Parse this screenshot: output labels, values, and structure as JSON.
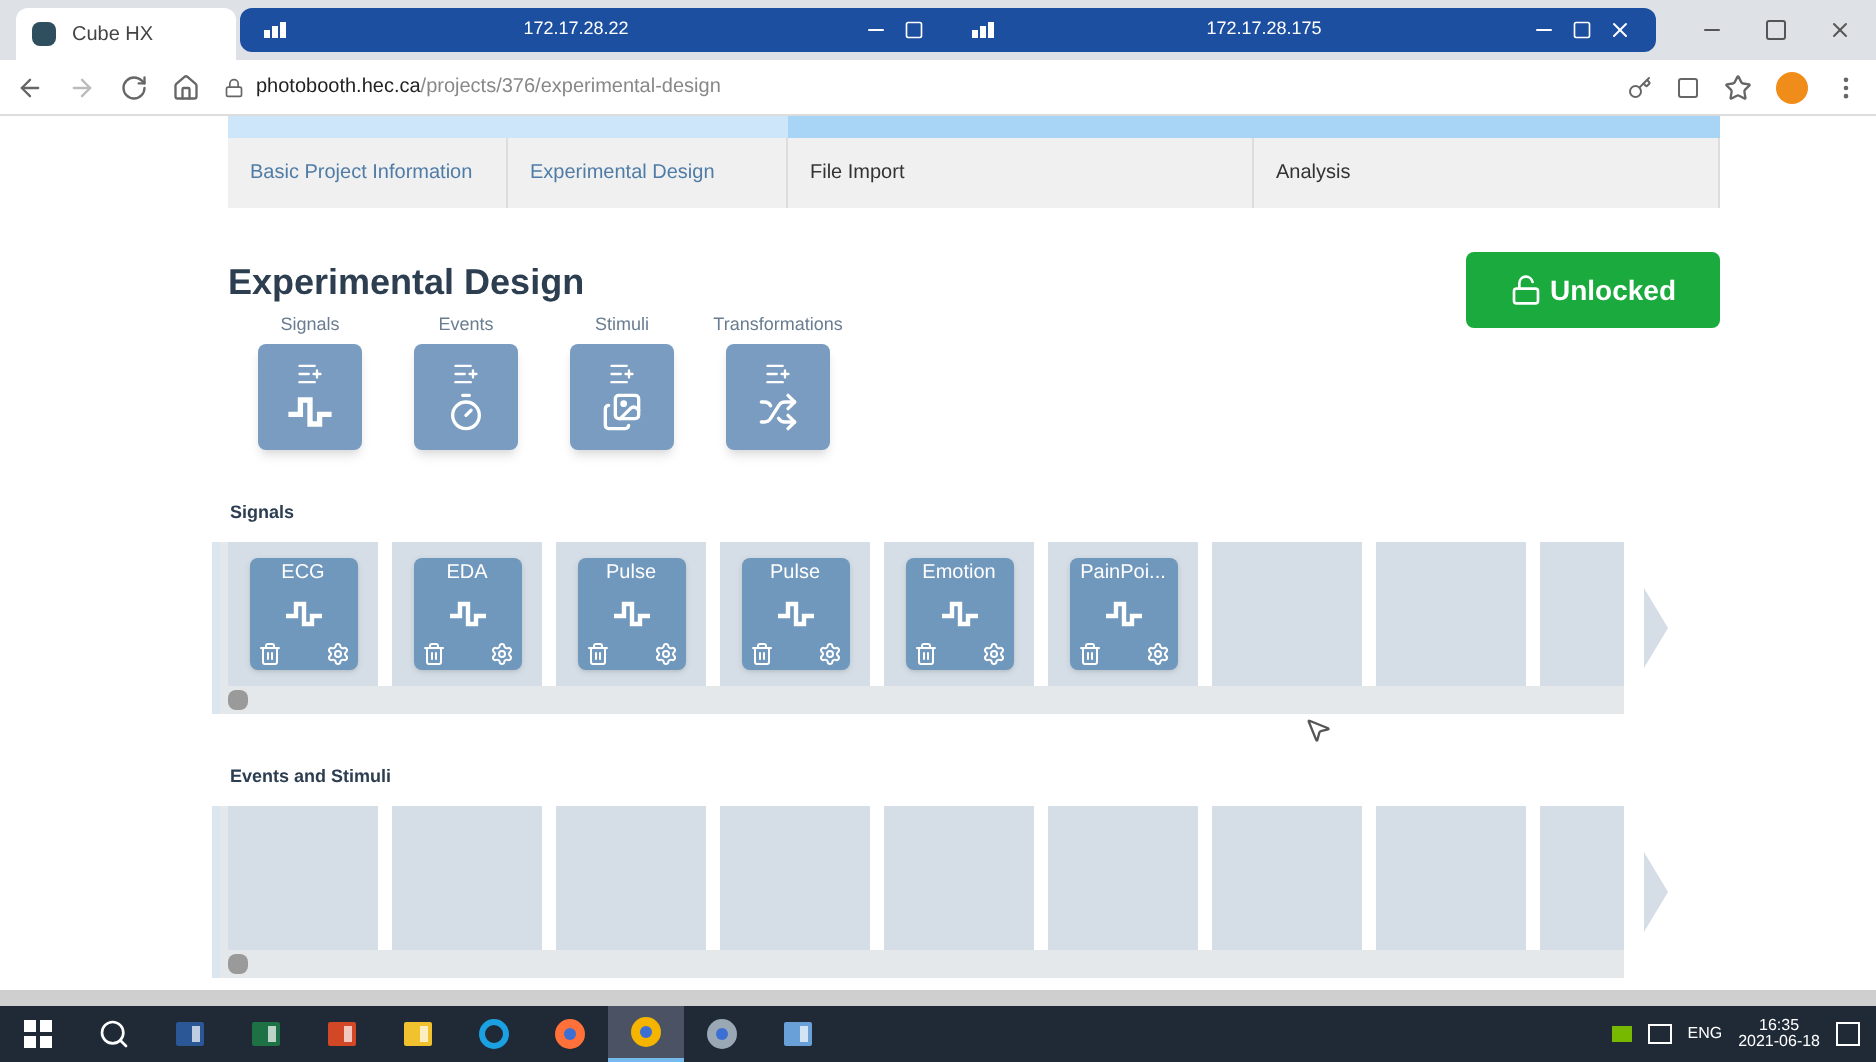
{
  "browser": {
    "tab_title": "Cube HX",
    "remote_bars": [
      {
        "ip": "172.17.28.22"
      },
      {
        "ip": "172.17.28.175"
      }
    ],
    "address": {
      "host": "photobooth.hec.ca",
      "path": "/projects/376/experimental-design"
    }
  },
  "steps": [
    {
      "label": "Basic Project Information",
      "done": true
    },
    {
      "label": "Experimental Design",
      "done": true
    },
    {
      "label": "File Import",
      "done": false
    },
    {
      "label": "Analysis",
      "done": false
    }
  ],
  "heading": "Experimental Design",
  "lock_button": {
    "label": "Unlocked"
  },
  "tools": [
    {
      "label": "Signals",
      "kind": "signal"
    },
    {
      "label": "Events",
      "kind": "timer"
    },
    {
      "label": "Stimuli",
      "kind": "media"
    },
    {
      "label": "Transformations",
      "kind": "shuffle"
    }
  ],
  "sections": [
    {
      "title": "Signals",
      "slots": [
        {
          "kind": "signal",
          "name": "ECG"
        },
        {
          "kind": "signal",
          "name": "EDA"
        },
        {
          "kind": "signal",
          "name": "Pulse"
        },
        {
          "kind": "signal",
          "name": "Pulse"
        },
        {
          "kind": "signal",
          "name": "Emotion"
        },
        {
          "kind": "signal",
          "name": "PainPoi..."
        },
        {
          "kind": "empty"
        },
        {
          "kind": "empty"
        },
        {
          "kind": "empty"
        }
      ]
    },
    {
      "title": "Events and Stimuli",
      "slots": [
        {
          "kind": "empty"
        },
        {
          "kind": "empty"
        },
        {
          "kind": "empty"
        },
        {
          "kind": "empty"
        },
        {
          "kind": "empty"
        },
        {
          "kind": "empty"
        },
        {
          "kind": "empty"
        },
        {
          "kind": "empty"
        },
        {
          "kind": "empty"
        }
      ]
    }
  ],
  "taskbar": {
    "apps": [
      {
        "kind": "start",
        "selected": false
      },
      {
        "kind": "search",
        "selected": false
      },
      {
        "kind": "word",
        "selected": false
      },
      {
        "kind": "excel",
        "selected": false
      },
      {
        "kind": "powerpoint",
        "selected": false
      },
      {
        "kind": "folder",
        "selected": false
      },
      {
        "kind": "ie",
        "selected": false
      },
      {
        "kind": "firefox",
        "selected": false
      },
      {
        "kind": "chrome",
        "selected": true
      },
      {
        "kind": "disc",
        "selected": false
      },
      {
        "kind": "notepad",
        "selected": false
      }
    ],
    "language": "ENG",
    "time": "16:35",
    "date": "2021-06-18"
  }
}
